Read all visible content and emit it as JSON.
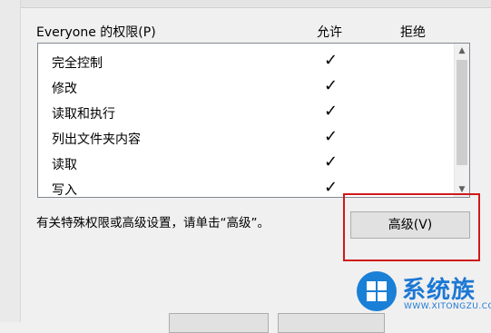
{
  "permissions": {
    "title": "Everyone 的权限(P)",
    "col_allow": "允许",
    "col_deny": "拒绝",
    "rows": [
      {
        "label": "完全控制",
        "allow": "✓",
        "deny": ""
      },
      {
        "label": "修改",
        "allow": "✓",
        "deny": ""
      },
      {
        "label": "读取和执行",
        "allow": "✓",
        "deny": ""
      },
      {
        "label": "列出文件夹内容",
        "allow": "✓",
        "deny": ""
      },
      {
        "label": "读取",
        "allow": "✓",
        "deny": ""
      },
      {
        "label": "写入",
        "allow": "✓",
        "deny": ""
      }
    ]
  },
  "advanced": {
    "hint": "有关特殊权限或高级设置，请单击“高级”。",
    "button_label": "高级(V)"
  },
  "highlight_color": "#d0191b",
  "watermark": {
    "brand": "系统族",
    "url": "WWW.XITONGZU.COM"
  }
}
